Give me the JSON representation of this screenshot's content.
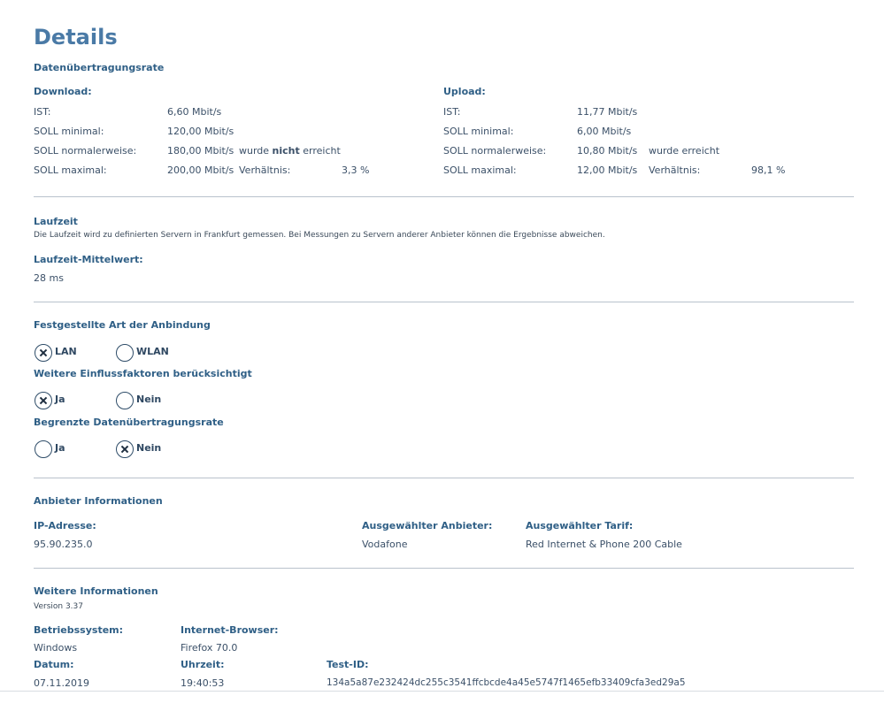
{
  "page": {
    "title": "Details"
  },
  "rate": {
    "heading": "Datenübertragungsrate",
    "download": {
      "heading": "Download:",
      "rows": [
        {
          "label": "IST:",
          "value": "6,60 Mbit/s"
        },
        {
          "label": "SOLL minimal:",
          "value": "120,00 Mbit/s"
        },
        {
          "label": "SOLL normalerweise:",
          "value": "180,00 Mbit/s"
        },
        {
          "label": "SOLL maximal:",
          "value": "200,00 Mbit/s"
        }
      ],
      "status_prefix": "wurde ",
      "status_bold": "nicht",
      "status_suffix": " erreicht",
      "ratio_label": "Verhältnis:",
      "ratio_value": "3,3 %"
    },
    "upload": {
      "heading": "Upload:",
      "rows": [
        {
          "label": "IST:",
          "value": "11,77 Mbit/s"
        },
        {
          "label": "SOLL minimal:",
          "value": "6,00 Mbit/s"
        },
        {
          "label": "SOLL normalerweise:",
          "value": "10,80 Mbit/s"
        },
        {
          "label": "SOLL maximal:",
          "value": "12,00 Mbit/s"
        }
      ],
      "status": "wurde erreicht",
      "ratio_label": "Verhältnis:",
      "ratio_value": "98,1 %"
    }
  },
  "latency": {
    "heading": "Laufzeit",
    "note": "Die Laufzeit wird zu definierten Servern in Frankfurt gemessen. Bei Messungen zu Servern anderer Anbieter können die Ergebnisse abweichen.",
    "mean_label": "Laufzeit-Mittelwert:",
    "mean_value": "28 ms"
  },
  "connection": {
    "heading": "Festgestellte Art der Anbindung",
    "options": [
      {
        "label": "LAN",
        "selected": true
      },
      {
        "label": "WLAN",
        "selected": false
      }
    ],
    "factors_heading": "Weitere Einflussfaktoren berücksichtigt",
    "factors_options": [
      {
        "label": "Ja",
        "selected": true
      },
      {
        "label": "Nein",
        "selected": false
      }
    ],
    "limited_heading": "Begrenzte Datenübertragungsrate",
    "limited_options": [
      {
        "label": "Ja",
        "selected": false
      },
      {
        "label": "Nein",
        "selected": true
      }
    ]
  },
  "provider": {
    "heading": "Anbieter Informationen",
    "ip_label": "IP-Adresse:",
    "ip_value": "95.90.235.0",
    "provider_label": "Ausgewählter Anbieter:",
    "provider_value": "Vodafone",
    "tariff_label": "Ausgewählter Tarif:",
    "tariff_value": "Red Internet & Phone 200 Cable"
  },
  "info": {
    "heading": "Weitere Informationen",
    "version": "Version 3.37",
    "os_label": "Betriebssystem:",
    "os_value": "Windows",
    "browser_label": "Internet-Browser:",
    "browser_value": "Firefox 70.0",
    "date_label": "Datum:",
    "date_value": "07.11.2019",
    "time_label": "Uhrzeit:",
    "time_value": "19:40:53",
    "testid_label": "Test-ID:",
    "testid_value": "134a5a87e232424dc255c3541ffcbcde4a45e5747f1465efb33409cfa3ed29a5"
  },
  "icons": {
    "radio_checked": "x-mark-icon",
    "radio_unchecked": "empty-circle-icon"
  }
}
